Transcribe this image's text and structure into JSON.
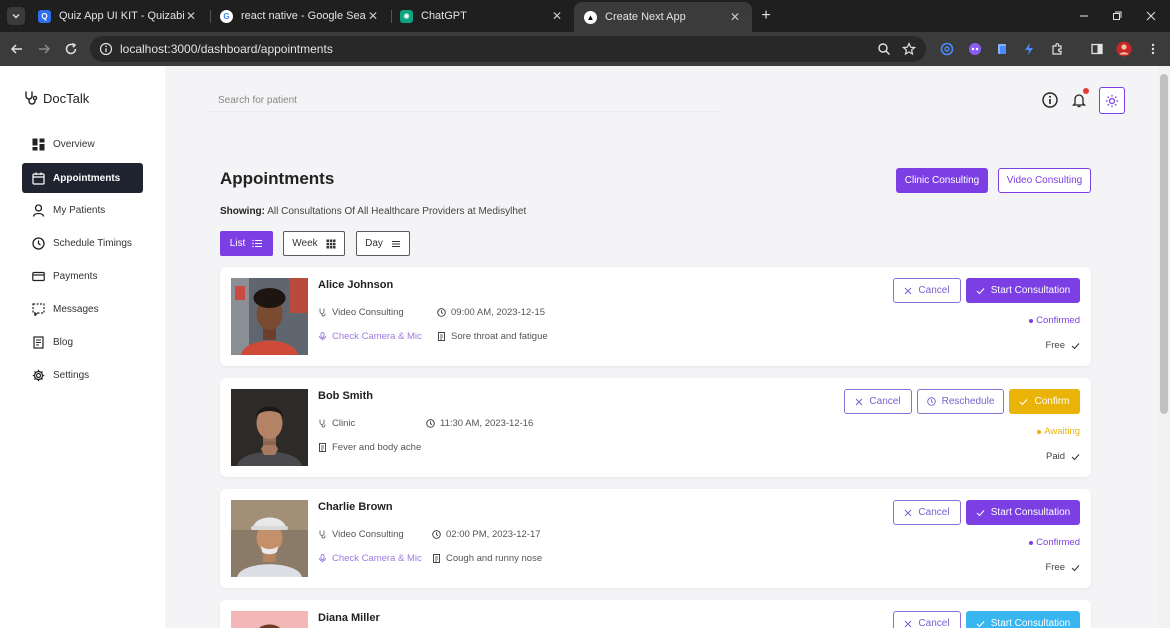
{
  "browser": {
    "tabs": [
      {
        "title": "Quiz App UI KIT - Quizabi",
        "favicon": "quizabi-logo-icon"
      },
      {
        "title": "react native - Google Search",
        "favicon": "google-logo-icon"
      },
      {
        "title": "ChatGPT",
        "favicon": "chatgpt-logo-icon"
      },
      {
        "title": "Create Next App",
        "favicon": "nextjs-logo-icon"
      }
    ],
    "active_tab": 3,
    "url": "localhost:3000/dashboard/appointments"
  },
  "sidebar": {
    "logo": "DocTalk",
    "items": [
      {
        "label": "Overview",
        "icon": "grid-icon"
      },
      {
        "label": "Appointments",
        "icon": "calendar-icon"
      },
      {
        "label": "My Patients",
        "icon": "user-icon"
      },
      {
        "label": "Schedule Timings",
        "icon": "clock-icon"
      },
      {
        "label": "Payments",
        "icon": "card-icon"
      },
      {
        "label": "Messages",
        "icon": "message-icon"
      },
      {
        "label": "Blog",
        "icon": "document-icon"
      },
      {
        "label": "Settings",
        "icon": "gear-icon"
      }
    ],
    "active_item": 1
  },
  "header": {
    "search_placeholder": "Search for patient"
  },
  "main": {
    "title": "Appointments",
    "clinic_button": "Clinic Consulting",
    "video_button": "Video Consulting",
    "showing_label": "Showing:",
    "showing_text": "All Consultations Of All Healthcare Providers at Medisylhet",
    "views": [
      "List",
      "Week",
      "Day"
    ],
    "active_view": "List"
  },
  "appointments": [
    {
      "name": "Alice Johnson",
      "type": "Video Consulting",
      "time": "09:00 AM, 2023-12-15",
      "check": "Check Camera & Mic",
      "reason": "Sore throat and fatigue",
      "status": "Confirmed",
      "payment": "Free",
      "cancel": "Cancel",
      "action": "Start Consultation"
    },
    {
      "name": "Bob Smith",
      "type": "Clinic",
      "time": "11:30 AM, 2023-12-16",
      "reason": "Fever and body ache",
      "status": "Awaiting",
      "payment": "Paid",
      "cancel": "Cancel",
      "reschedule": "Reschedule",
      "action": "Confirm"
    },
    {
      "name": "Charlie Brown",
      "type": "Video Consulting",
      "time": "02:00 PM, 2023-12-17",
      "check": "Check Camera & Mic",
      "reason": "Cough and runny nose",
      "status": "Confirmed",
      "payment": "Free",
      "cancel": "Cancel",
      "action": "Start Consultation"
    },
    {
      "name": "Diana Miller",
      "cancel": "Cancel",
      "action": "Start Consultation"
    }
  ],
  "colors": {
    "accent": "#7b3fe4",
    "sidebar_active": "#1f2430",
    "confirm": "#eab308",
    "awaiting": "#eab308",
    "start_alt": "#38b6f0"
  }
}
